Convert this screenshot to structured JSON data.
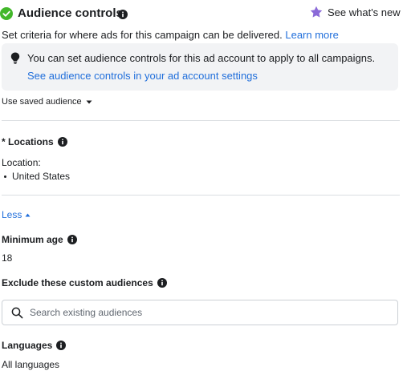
{
  "header": {
    "title": "Audience controls",
    "whats_new": "See what's new"
  },
  "description": {
    "text": "Set criteria for where ads for this campaign can be delivered.",
    "learn_more": "Learn more"
  },
  "notice": {
    "text": "You can set audience controls for this ad account to apply to all campaigns.",
    "link": "See audience controls in your ad account settings"
  },
  "saved_audience": {
    "label": "Use saved audience"
  },
  "locations": {
    "title": "Locations",
    "required_mark": "*",
    "label": "Location:",
    "items": [
      "United States"
    ]
  },
  "toggle": {
    "label": "Less"
  },
  "minimum_age": {
    "title": "Minimum age",
    "value": "18"
  },
  "exclude": {
    "title": "Exclude these custom audiences",
    "placeholder": "Search existing audiences"
  },
  "languages": {
    "title": "Languages",
    "value": "All languages"
  },
  "colors": {
    "accent_link": "#216fdb",
    "success_green": "#42b72a",
    "star_purple": "#8b6ad8",
    "notice_bg": "#f2f3f5",
    "divider": "#dadde1"
  },
  "icons": {
    "check": "check-circle-icon",
    "info": "info-icon",
    "star": "star-icon",
    "bulb": "lightbulb-icon",
    "caret": "caret-down-icon",
    "caret_up": "caret-up-icon",
    "search": "search-icon"
  }
}
